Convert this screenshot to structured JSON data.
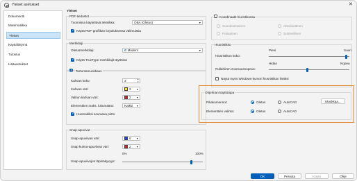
{
  "window": {
    "title": "Yleiset asetukset"
  },
  "sidebar": {
    "items": [
      {
        "label": "Dokumentti",
        "selected": false
      },
      {
        "label": "Matematiikka",
        "selected": false
      },
      {
        "label": "Yleiset",
        "selected": true
      },
      {
        "label": "Käyttöliittymä",
        "selected": false
      },
      {
        "label": "Tulostus",
        "selected": false
      },
      {
        "label": "Lisäasetukset",
        "selected": false
      }
    ]
  },
  "general": {
    "heading": "Yleiset",
    "pdf": {
      "title": "PDF-tiedostot",
      "tech_label": "Tuonnissa käytettävä tekniikka:",
      "tech_value": "OBA (Oletus)",
      "use_graphics": "Käytä PDF-grafiikan lorjoituksessa välimuistia"
    },
    "font": {
      "title": "Merkkilaji",
      "default_label": "Oletusmerkkilaji:",
      "default_value": "Modern",
      "truetype": "Käytä TrueType-merkkilajit täyttöinä"
    },
    "snap": {
      "title": "Tartuntamuokkaus",
      "size_label": "Kahvan koko:",
      "size_value": "3",
      "color_label": "Kahvan väri:",
      "color_value": "3",
      "color_hex": "#ffe600",
      "selected_color_label": "Valitun kahvan väri:",
      "selected_color_value": "2",
      "selected_color_hex": "#d81e1e",
      "limit_label": "Elementtien maks. lukumäärä:",
      "limit_value": "Kaikki",
      "highlight": "Huomatiiksi seuraava piirto"
    },
    "snap_aids": {
      "title": "Snap-apuvivat",
      "color_label": "Snap-apuviivan väri:",
      "color_value": "6",
      "color_hex": "#1f3cff",
      "angle_color_label": "Snap kulma-apuviivan väri:",
      "angle_color_value": "2",
      "angle_color_hex": "#d81e1e",
      "opacity_min": "0%",
      "opacity_max": "100%",
      "opacity_label": "Snap-apuviivojen läpinäkyvyys:",
      "opacity_level": 0.86
    },
    "coords": {
      "title": "Koordinaatit hiuristikossa",
      "options": [
        "Suorakulmainen",
        "Absoluuttinen",
        "Polaarinen",
        "Suhteellinen"
      ]
    },
    "crosshair": {
      "title": "Hiusristikko",
      "small": "Pieni",
      "large": "Suuri",
      "size_label": "Hiusristikon koko:",
      "size_level": 0.96,
      "slow": "Hidas",
      "fast": "Nopea",
      "speed_label": "Rullahiiren zoomausnopeus:",
      "speed_level": 0.48,
      "windows_cursor": "Näytä myös Windows-kursori hiusristikon lisäksi"
    },
    "programs": {
      "title": "Ohjelman käyttötapa",
      "mode_label": "Pikakomennot:",
      "default": "Oletus",
      "autocad": "AutoCAD",
      "edit_button": "Muokkaa...",
      "selection_label": "Elementtien valinta:"
    }
  },
  "footer": {
    "ok": "OK",
    "cancel": "Peruuta",
    "apply": "Käytä",
    "help": "Ohje"
  },
  "colors": {
    "accent": "#005fb8",
    "highlight_box": "#e0852c"
  }
}
